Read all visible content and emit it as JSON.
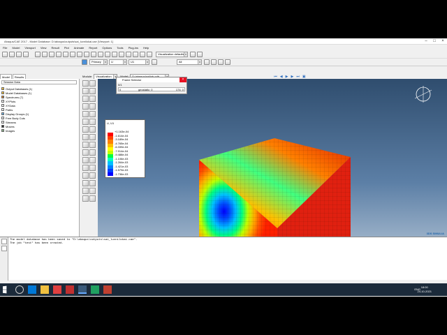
{
  "window": {
    "title": "Abaqus/CAE 2017 - Model Database: D:\\abaqus\\outputs\\sai_luvnilokai.cae [Viewport: 1]"
  },
  "menu": [
    "File",
    "Model",
    "Viewport",
    "View",
    "Result",
    "Plot",
    "Animate",
    "Report",
    "Options",
    "Tools",
    "Plug-ins",
    "Help"
  ],
  "toolbar": {
    "primary_combo": "Primary",
    "var_combo": "U",
    "comp_combo": "U1",
    "visualization_combo": "Visualization defaults",
    "all_combo": "All"
  },
  "tabs": {
    "model": "Model",
    "results": "Results"
  },
  "module": {
    "label": "Module:",
    "value": "Visualization",
    "model_label": "Model:",
    "model_value": "D:/abaqus/sai/job.odb"
  },
  "tree": {
    "header": "Session Data",
    "items": [
      "Output Databases (1)",
      "Model Databases (1)",
      "Spectrums (7)",
      "XYPlots",
      "XYData",
      "Paths",
      "Display Groups (1)",
      "Free Body Cuts",
      "Streams",
      "Movies",
      "Images"
    ]
  },
  "frame_selector": {
    "title": "Frame Selector",
    "step_index": "0/1",
    "start": "0",
    "frame_label": "geostatic: 0",
    "end": "174: 0"
  },
  "legend": {
    "title": "U, U1",
    "values": [
      "+1.163e-04",
      "-1.614e-04",
      "-3.189e-04",
      "-4.765e-04",
      "-6.339e-04",
      "-7.914e-04",
      "-9.488e-04",
      "-1.106e-03",
      "-1.264e-03",
      "-1.421e-03",
      "-1.579e-03",
      "-1.736e-03"
    ],
    "colors": [
      "#ff0000",
      "#ff4000",
      "#ff8000",
      "#ffbf00",
      "#ffff00",
      "#bfff00",
      "#00ff40",
      "#00ffbf",
      "#00bfff",
      "#0080ff",
      "#0040ff",
      "#0000ff"
    ]
  },
  "viewport_info": {
    "odb": "ODB: test.odb    Abaqus/Standard 3DEXPERIENCE R2017x    Tue Jan 05 19:00 India Standard Time 2021",
    "step": "Step: Cl3",
    "increment": "Increment    163: Step Time =    5.1840E+05",
    "primary": "Primary Var: U, U1",
    "deformed": "Deformed Var: U   Deformation Scale Factor: +1.000e+00"
  },
  "brand": "3DS SIMULIA",
  "command": {
    "lines": [
      "The model database has been saved to \"D:\\abaqus\\outputs\\sai_luvnilokai.cae\".",
      "The job \"test\" has been created."
    ]
  },
  "taskbar": {
    "time": "18:00",
    "date": "24-10-2021",
    "lang": "ENG"
  }
}
